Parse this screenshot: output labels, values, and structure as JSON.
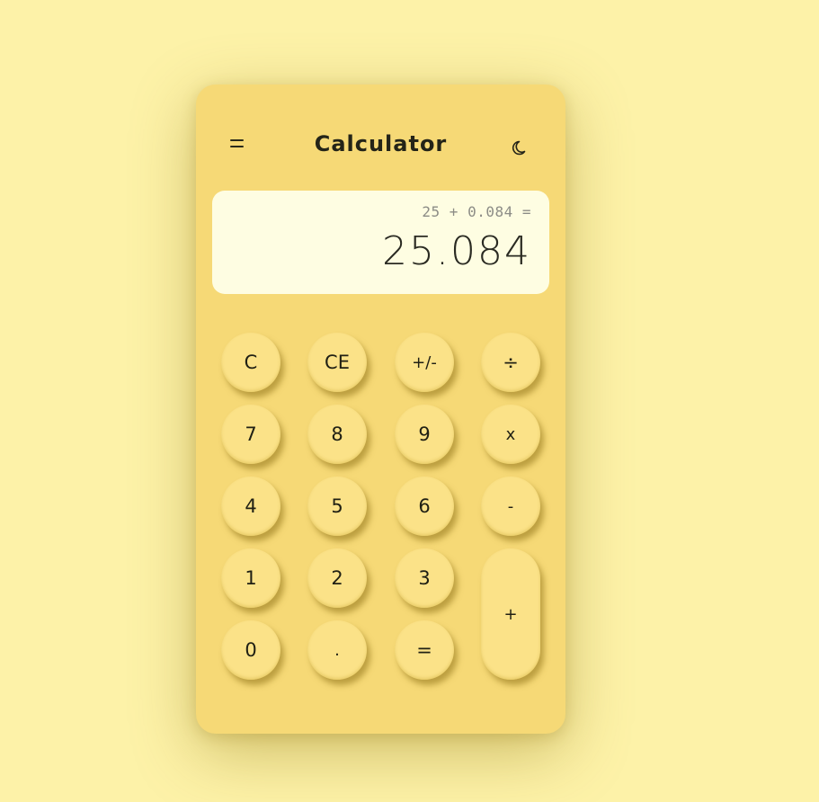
{
  "app": {
    "title": "Calculator",
    "menu_icon": "menu-icon",
    "theme_icon": "moon-icon"
  },
  "display": {
    "expression": "25 + 0.084 =",
    "result": "25.084"
  },
  "keys": {
    "clear": "C",
    "clear_entry": "CE",
    "negate": "+/-",
    "divide": "÷",
    "seven": "7",
    "eight": "8",
    "nine": "9",
    "multiply": "x",
    "four": "4",
    "five": "5",
    "six": "6",
    "subtract": "-",
    "one": "1",
    "two": "2",
    "three": "3",
    "add": "+",
    "zero": "0",
    "decimal": ".",
    "equals": "="
  },
  "colors": {
    "page_background": "#fdf2a8",
    "calculator_body": "#f6d976",
    "display_background": "#fefde2",
    "key_face": "#fbe288",
    "text": "#242418"
  }
}
